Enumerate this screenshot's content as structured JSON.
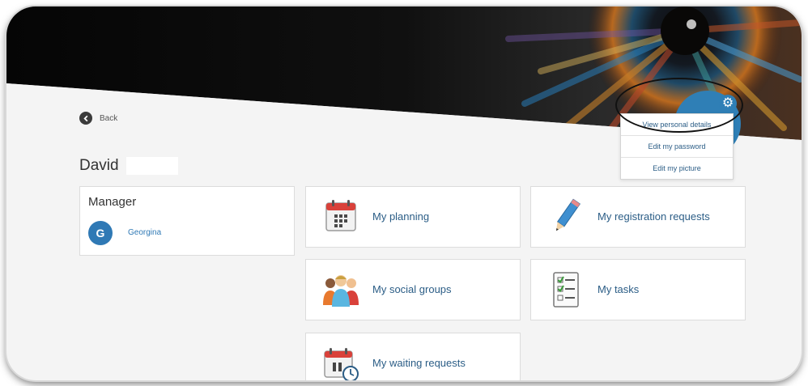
{
  "back": {
    "label": "Back"
  },
  "user": {
    "name": "David"
  },
  "manager": {
    "title": "Manager",
    "avatar_initial": "G",
    "name": "Georgina"
  },
  "tiles": [
    {
      "label": "My planning",
      "icon": "calendar-icon"
    },
    {
      "label": "My registration requests",
      "icon": "pencil-icon"
    },
    {
      "label": "My social groups",
      "icon": "people-group-icon"
    },
    {
      "label": "My tasks",
      "icon": "checklist-icon"
    },
    {
      "label": "My waiting requests",
      "icon": "calendar-pause-clock-icon"
    }
  ],
  "profile_menu": {
    "items": [
      "View personal details",
      "Edit my password",
      "Edit my picture"
    ],
    "icon": "gear-icon"
  },
  "colors": {
    "accent": "#2f79b5",
    "link": "#2b5d86",
    "banner_dark": "#0d0d0d"
  }
}
